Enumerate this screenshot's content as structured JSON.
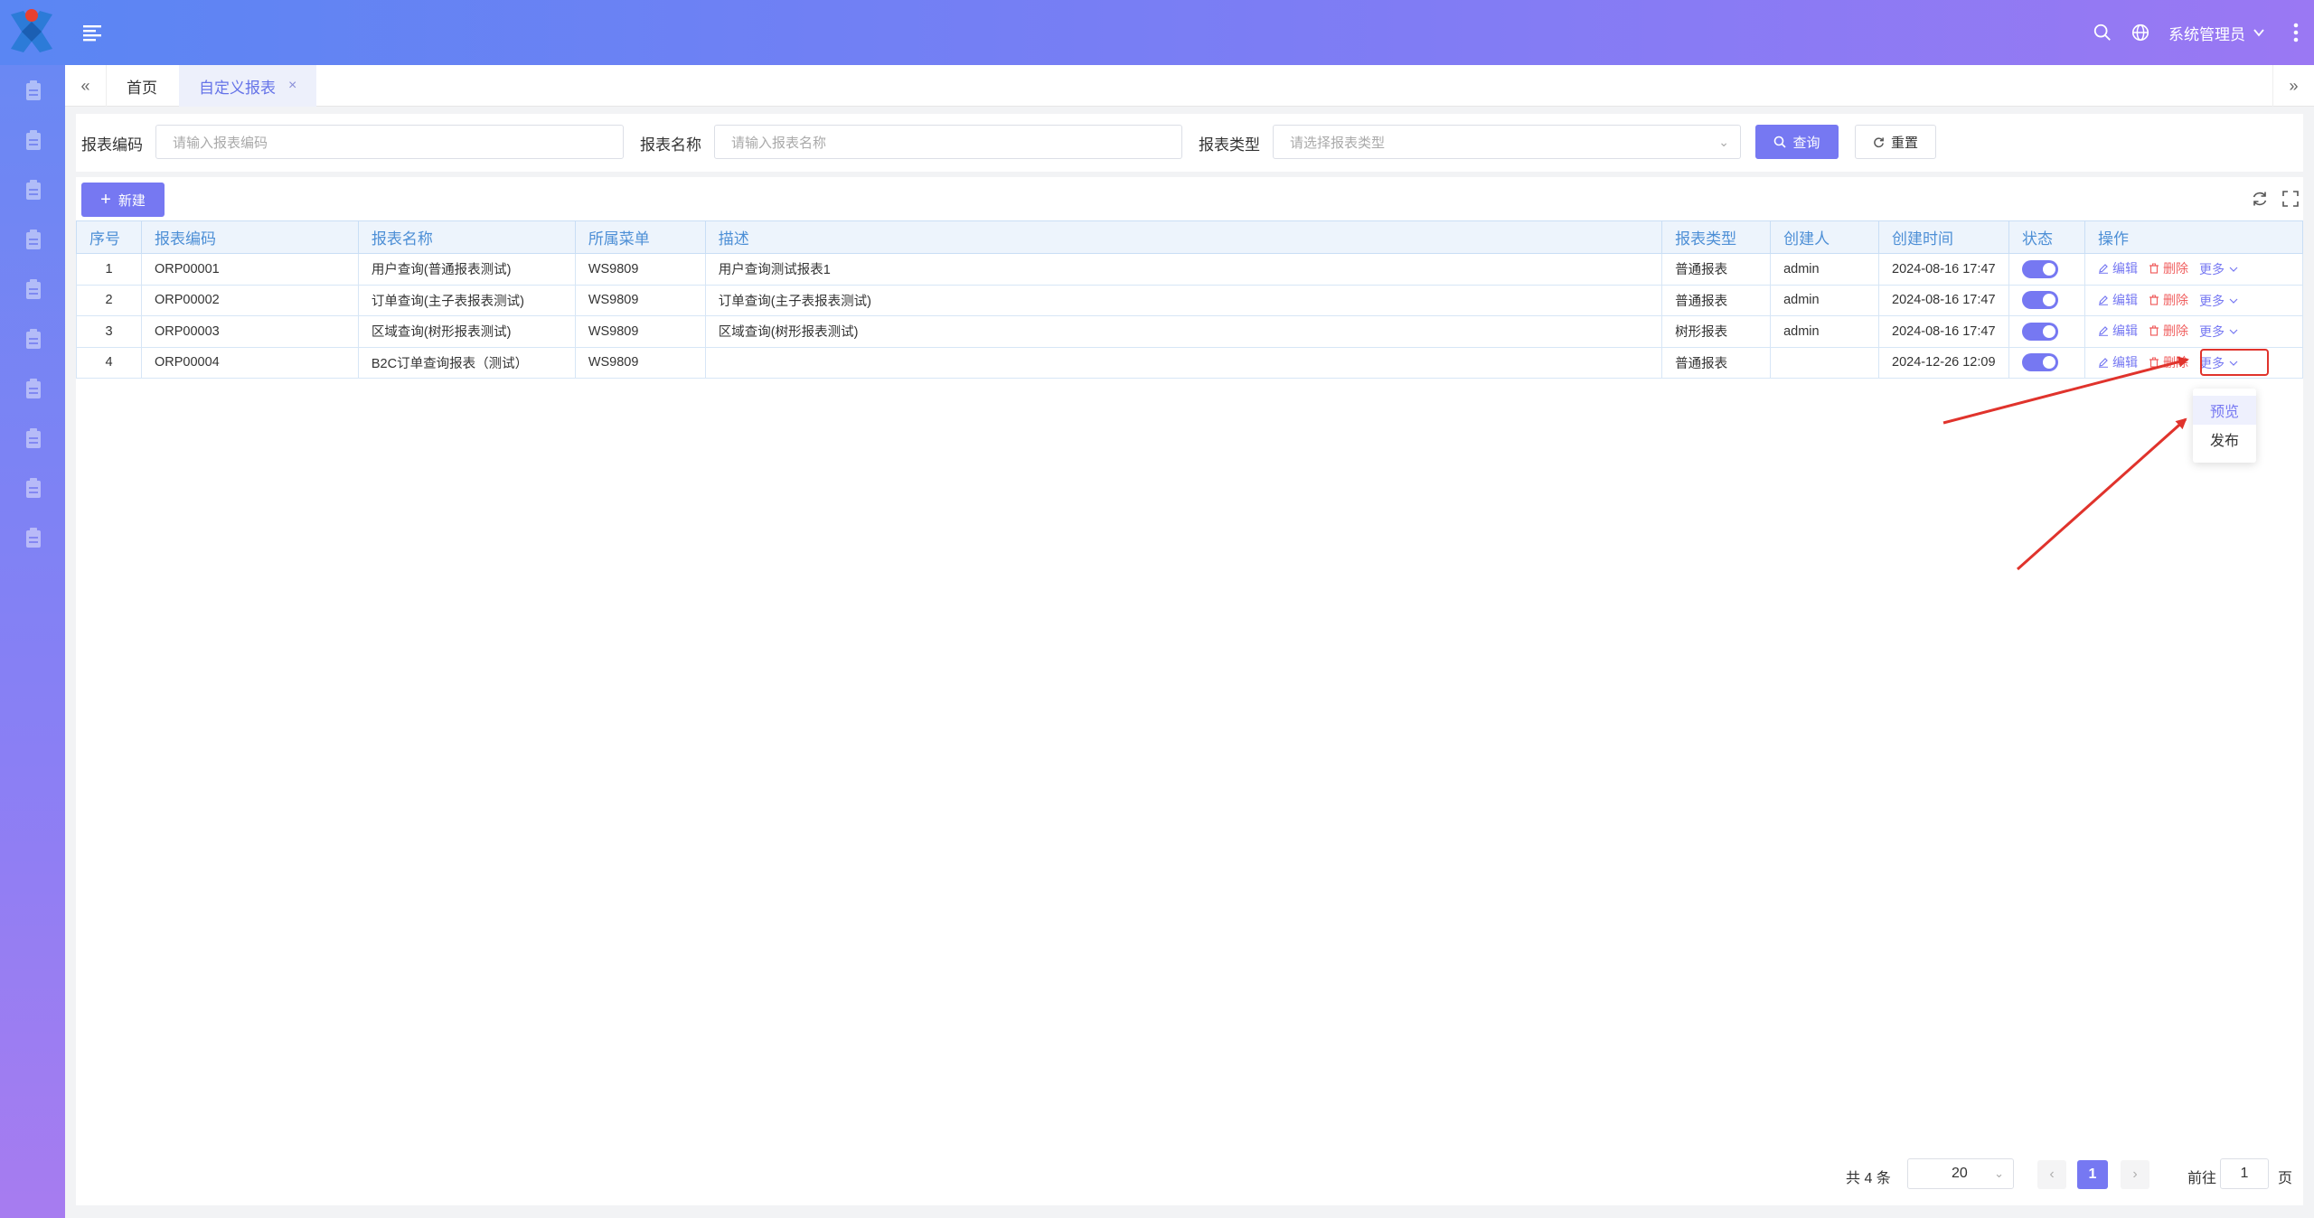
{
  "header": {
    "user_name": "系统管理员"
  },
  "tabs": [
    {
      "label": "首页"
    },
    {
      "label": "自定义报表"
    }
  ],
  "search": {
    "code_label": "报表编码",
    "code_placeholder": "请输入报表编码",
    "name_label": "报表名称",
    "name_placeholder": "请输入报表名称",
    "type_label": "报表类型",
    "type_placeholder": "请选择报表类型",
    "query_label": "查询",
    "reset_label": "重置"
  },
  "toolbar": {
    "new_label": "新建"
  },
  "table": {
    "columns": [
      "序号",
      "报表编码",
      "报表名称",
      "所属菜单",
      "描述",
      "报表类型",
      "创建人",
      "创建时间",
      "状态",
      "操作"
    ],
    "rows": [
      {
        "no": "1",
        "code": "ORP00001",
        "name": "用户查询(普通报表测试)",
        "menu": "WS9809",
        "desc": "用户查询测试报表1",
        "type": "普通报表",
        "creator": "admin",
        "time": "2024-08-16 17:47",
        "enabled": true
      },
      {
        "no": "2",
        "code": "ORP00002",
        "name": "订单查询(主子表报表测试)",
        "menu": "WS9809",
        "desc": "订单查询(主子表报表测试)",
        "type": "普通报表",
        "creator": "admin",
        "time": "2024-08-16 17:47",
        "enabled": true
      },
      {
        "no": "3",
        "code": "ORP00003",
        "name": "区域查询(树形报表测试)",
        "menu": "WS9809",
        "desc": "区域查询(树形报表测试)",
        "type": "树形报表",
        "creator": "admin",
        "time": "2024-08-16 17:47",
        "enabled": true
      },
      {
        "no": "4",
        "code": "ORP00004",
        "name": "B2C订单查询报表（测试）",
        "menu": "WS9809",
        "desc": "",
        "type": "普通报表",
        "creator": "",
        "time": "2024-12-26 12:09",
        "enabled": true
      }
    ],
    "actions": {
      "edit": "编辑",
      "delete": "删除",
      "more": "更多"
    }
  },
  "dropdown": {
    "items": [
      "预览",
      "发布"
    ]
  },
  "pagination": {
    "total": "共 4 条",
    "page_size": "20",
    "current_page": "1",
    "goto_label": "前往",
    "goto_value": "1",
    "page_suffix": "页"
  },
  "colors": {
    "primary": "#7678f2",
    "danger": "#f06060",
    "header_start": "#5a86f3",
    "header_end": "#9a78f3",
    "annotation": "#e0332c"
  }
}
